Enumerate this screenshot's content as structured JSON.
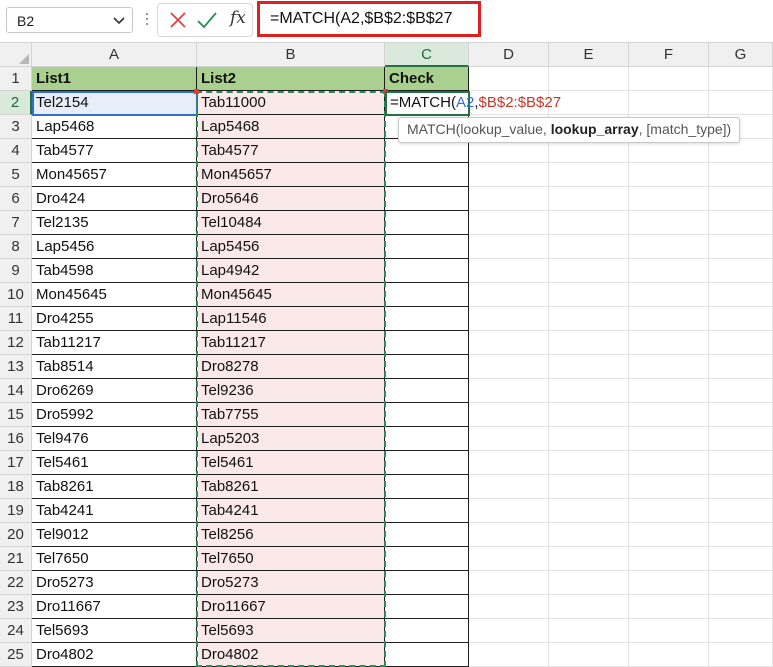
{
  "name_box": {
    "value": "B2"
  },
  "formula_bar": {
    "formula": "=MATCH(A2,$B$2:$B$27",
    "fx_label": "fx"
  },
  "columns": [
    "A",
    "B",
    "C",
    "D",
    "E",
    "F",
    "G"
  ],
  "rows": [
    "1",
    "2",
    "3",
    "4",
    "5",
    "6",
    "7",
    "8",
    "9",
    "10",
    "11",
    "12",
    "13",
    "14",
    "15",
    "16",
    "17",
    "18",
    "19",
    "20",
    "21",
    "22",
    "23",
    "24",
    "25"
  ],
  "headers": {
    "list1": "List1",
    "list2": "List2",
    "check": "Check"
  },
  "list1": [
    "Tel2154",
    "Lap5468",
    "Tab4577",
    "Mon45657",
    "Dro424",
    "Tel2135",
    "Lap5456",
    "Tab4598",
    "Mon45645",
    "Dro4255",
    "Tab11217",
    "Tab8514",
    "Dro6269",
    "Dro5992",
    "Tel9476",
    "Tel5461",
    "Tab8261",
    "Tab4241",
    "Tel9012",
    "Tel7650",
    "Dro5273",
    "Dro11667",
    "Tel5693",
    "Dro4802"
  ],
  "list2": [
    "Tab11000",
    "Lap5468",
    "Tab4577",
    "Mon45657",
    "Dro5646",
    "Tel10484",
    "Lap5456",
    "Lap4942",
    "Mon45645",
    "Lap11546",
    "Tab11217",
    "Dro8278",
    "Tel9236",
    "Tab7755",
    "Lap5203",
    "Tel5461",
    "Tab8261",
    "Tab4241",
    "Tel8256",
    "Tel7650",
    "Dro5273",
    "Dro11667",
    "Tel5693",
    "Dro4802"
  ],
  "editing_cell": {
    "part1": "=MATCH(",
    "part2": "A2",
    "part3": ",",
    "part4": "$B$2:$B$27"
  },
  "tooltip": {
    "prefix": "MATCH(lookup_value, ",
    "bold": "lookup_array",
    "suffix": ", [match_type])"
  },
  "colors": {
    "header_green": "#a9d08e",
    "list2_fill": "#fbe9e9",
    "ref_blue": "#2f6fd1",
    "ref_red": "#c0392b",
    "highlight_red": "#e02020"
  }
}
